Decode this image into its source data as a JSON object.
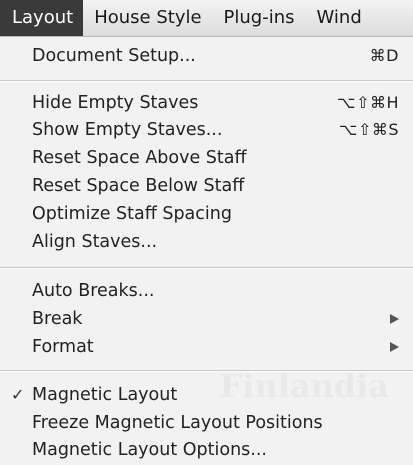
{
  "menubar": {
    "items": [
      {
        "label": "Layout",
        "active": true
      },
      {
        "label": "House Style"
      },
      {
        "label": "Plug-ins"
      },
      {
        "label": "Wind"
      }
    ]
  },
  "menu": {
    "groups": [
      [
        {
          "label": "Document Setup...",
          "shortcut": "⌘D"
        }
      ],
      [
        {
          "label": "Hide Empty Staves",
          "shortcut": "⌥⇧⌘H"
        },
        {
          "label": "Show Empty Staves...",
          "shortcut": "⌥⇧⌘S"
        },
        {
          "label": "Reset Space Above Staff"
        },
        {
          "label": "Reset Space Below Staff"
        },
        {
          "label": "Optimize Staff Spacing"
        },
        {
          "label": "Align Staves..."
        }
      ],
      [
        {
          "label": "Auto Breaks..."
        },
        {
          "label": "Break",
          "submenu": true
        },
        {
          "label": "Format",
          "submenu": true
        }
      ],
      [
        {
          "label": "Magnetic Layout",
          "checked": true
        },
        {
          "label": "Freeze Magnetic Layout Positions"
        },
        {
          "label": "Magnetic Layout Options..."
        }
      ]
    ]
  },
  "background_text": "Finlandia",
  "colors": {
    "menubar_active_bg": "#3a3a3a",
    "menu_bg": "#f2f2f2",
    "text": "#222222"
  }
}
